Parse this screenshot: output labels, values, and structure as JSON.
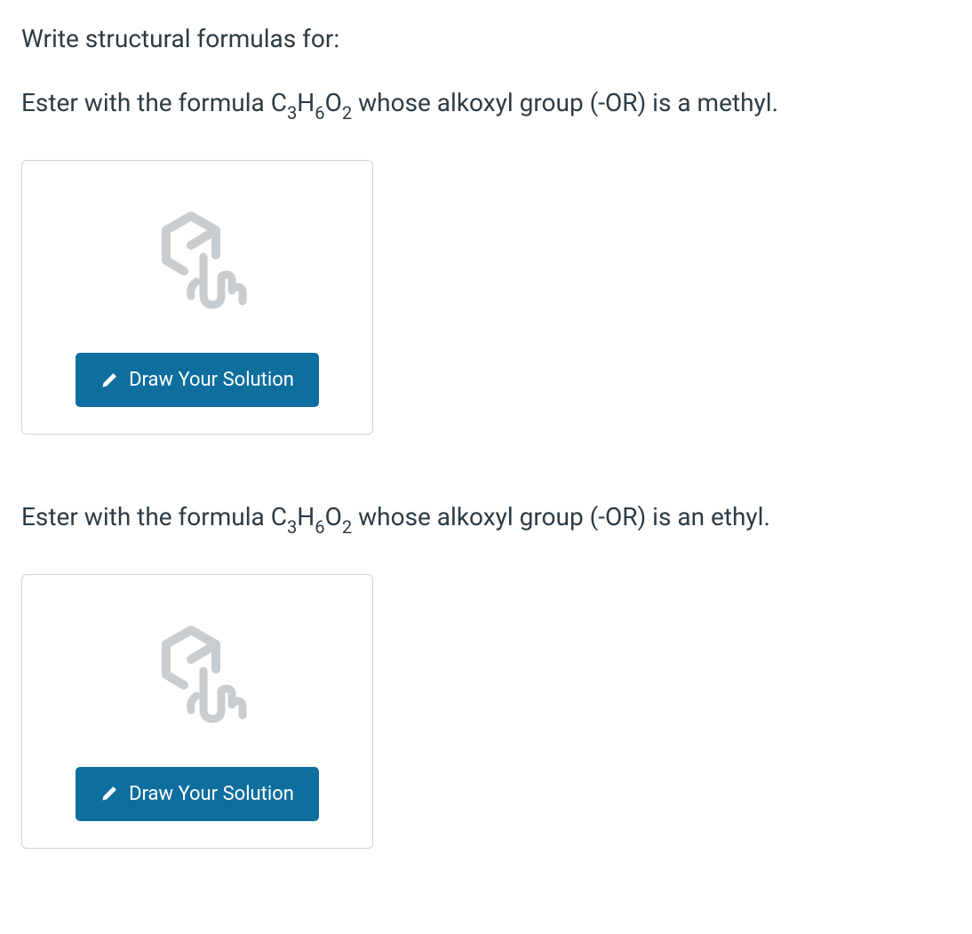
{
  "intro": "Write structural formulas for:",
  "questions": [
    {
      "prefix": "Ester with the formula C",
      "sub1": "3",
      "mid1": "H",
      "sub2": "6",
      "mid2": "O",
      "sub3": "2",
      "suffix": " whose alkoxyl group (-OR) is a methyl.",
      "button_label": "Draw Your Solution"
    },
    {
      "prefix": "Ester with the formula C",
      "sub1": "3",
      "mid1": "H",
      "sub2": "6",
      "mid2": "O",
      "sub3": "2",
      "suffix": " whose alkoxyl group (-OR) is an ethyl.",
      "button_label": "Draw Your Solution"
    }
  ],
  "colors": {
    "text": "#2d3b45",
    "button_bg": "#0e6e9e",
    "card_border": "#d0d4d8",
    "icon": "#c7cdd1"
  }
}
